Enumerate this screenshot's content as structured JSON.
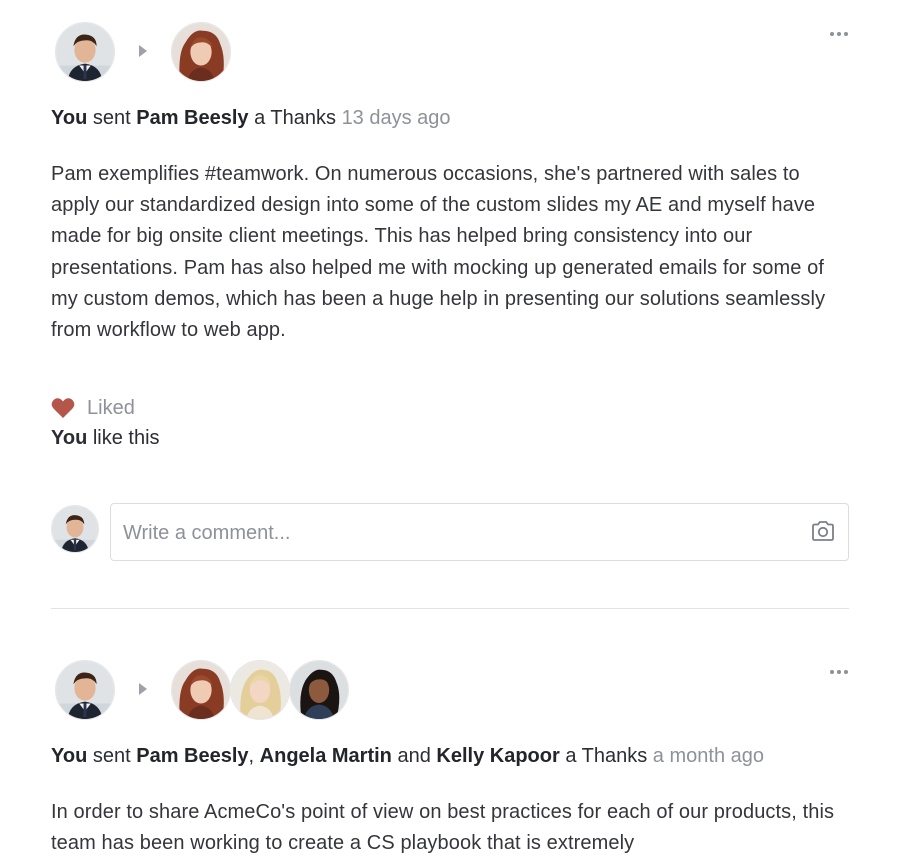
{
  "posts": [
    {
      "sender": "You",
      "verb": "sent",
      "recipients_line": "Pam Beesly",
      "object": "a Thanks",
      "timestamp": "13 days ago",
      "body": "Pam exemplifies #teamwork. On numerous occasions, she's partnered with sales to apply our standardized design into some of the custom slides my AE and myself have made for big onsite client meetings. This has helped bring consistency into our presentations. Pam has also helped me with mocking up generated emails for some of my custom demos, which has been a huge help in presenting our solutions seamlessly from workflow to web app.",
      "liked_label": "Liked",
      "likers_name": "You",
      "likers_suffix": "like this",
      "comment_placeholder": "Write a comment..."
    },
    {
      "sender": "You",
      "verb": "sent",
      "recipient_1": "Pam Beesly",
      "sep_1": ",",
      "recipient_2": "Angela Martin",
      "conj": "and",
      "recipient_3": "Kelly Kapoor",
      "object": "a Thanks",
      "timestamp": "a month ago",
      "body": "In order to share AcmeCo's point of view on best practices for each of our products, this team has been working to create a CS playbook that is extremely"
    }
  ],
  "colors": {
    "heart": "#b5564b",
    "timestamp": "#8e9199",
    "text": "#2b2d33",
    "divider": "#e2e3e6"
  },
  "icons": {
    "arrow": "caret-right-icon",
    "more": "more-horizontal-icon",
    "heart": "heart-icon",
    "camera": "camera-icon"
  }
}
